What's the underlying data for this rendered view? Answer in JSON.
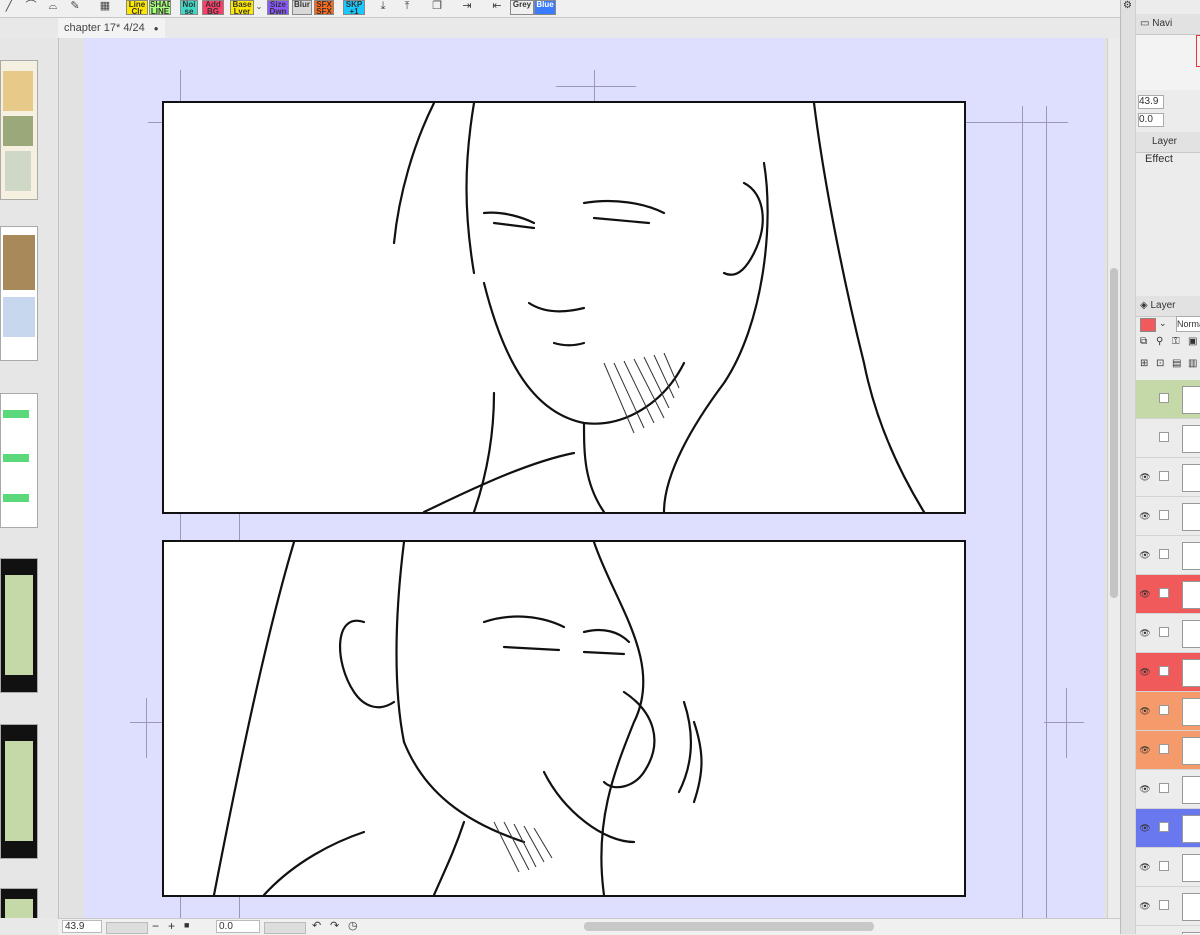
{
  "toolbar": {
    "buttons": [
      {
        "label": "Line Clr",
        "bg": "#ffe800"
      },
      {
        "label": "SHADE LINE",
        "bg": "#a8ff7a"
      },
      {
        "label": "Noi se",
        "bg": "#3fd8c6"
      },
      {
        "label": "Add BG",
        "bg": "#ff3d6a"
      },
      {
        "label": "Base Lyer",
        "bg": "#ffe800"
      },
      {
        "label": "Size Dwn",
        "bg": "#8a58ff"
      },
      {
        "label": "Blur",
        "bg": "#d8d8d8"
      },
      {
        "label": "SFX SFX",
        "bg": "#ff6a1a"
      },
      {
        "label": "SKP +1",
        "bg": "#19c8ff"
      },
      {
        "label": "Grey",
        "bg": "#f0f0f0"
      },
      {
        "label": "Blue",
        "bg": "#3b7cff"
      }
    ]
  },
  "tab": {
    "title": "chapter 17* 4/24",
    "close_symbol": "●"
  },
  "status": {
    "zoom": "43.9",
    "angle": "0.0",
    "minus": "−",
    "plus": "+"
  },
  "right_panel": {
    "navigator_label": "Navi",
    "zoom_value": "43.9",
    "angle_value": "0.0",
    "layer_prop_tab": "Layer",
    "effect_label": "Effect",
    "layer_tab": "Layer",
    "blend_mode": "Norma",
    "layer_colors": [
      "#c5d9a8",
      "#ffffff",
      "#ffffff",
      "#ffffff",
      "#ffffff",
      "#f05a5a",
      "#ffffff",
      "#f05a5a",
      "#f59a6a",
      "#f59a6a",
      "#ffffff",
      "#6a78f0",
      "#ffffff",
      "#ffffff",
      "#ffffff"
    ]
  },
  "colors": {
    "paper": "#dedeff",
    "accent_red": "#f05a5a",
    "accent_orange": "#f59a6a",
    "accent_blue": "#6a78f0"
  }
}
